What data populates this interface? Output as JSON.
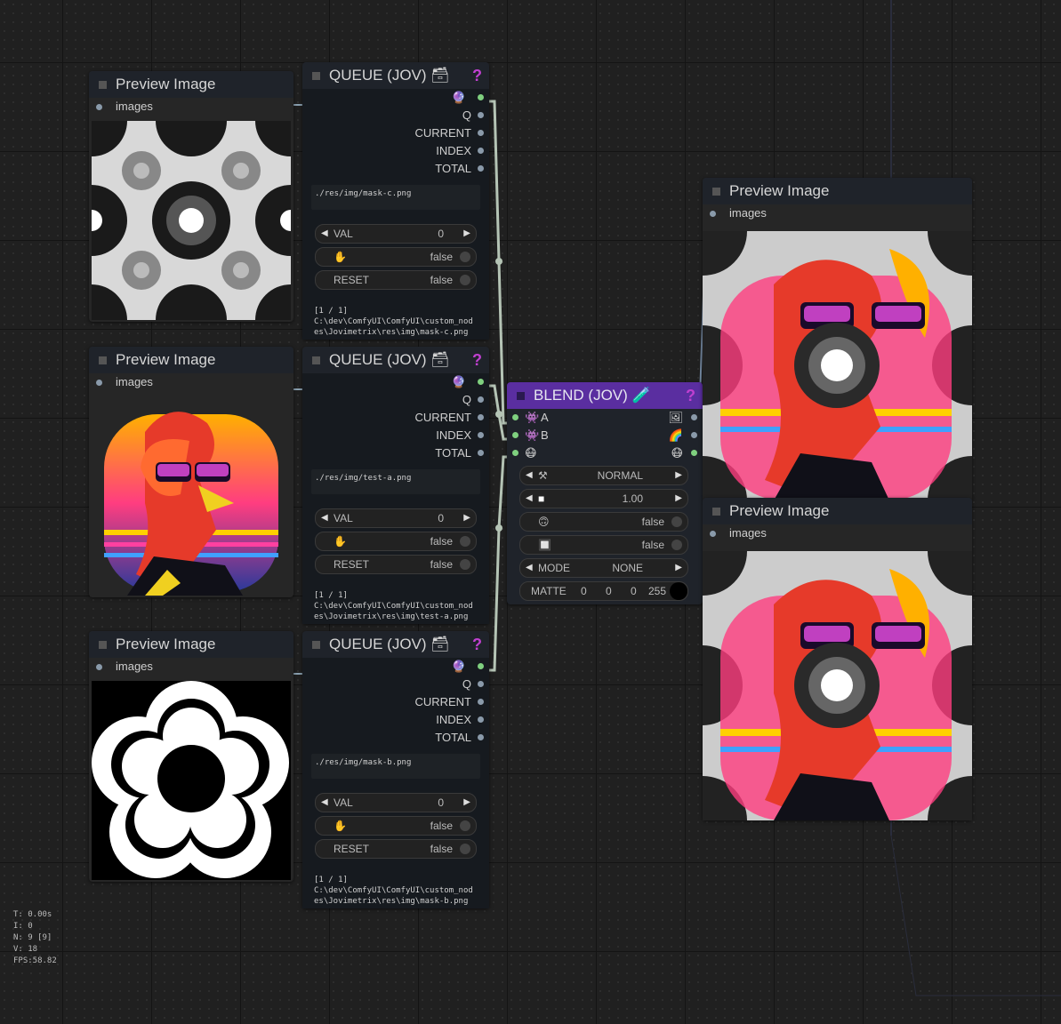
{
  "preview": {
    "title": "Preview Image",
    "input_label": "images"
  },
  "queues": [
    {
      "title": "QUEUE (JOV) 🗃",
      "help": "?",
      "outputs": [
        "Q",
        "CURRENT",
        "INDEX",
        "TOTAL"
      ],
      "path": "./res/img/mask-c.png",
      "val_label": "VAL",
      "val": "0",
      "toggle_false": "false",
      "reset_label": "RESET",
      "status_line1": "[1 / 1]",
      "status_line2": "C:\\dev\\ComfyUI\\ComfyUI\\custom_nodes\\Jovimetrix\\res\\img\\mask-c.png"
    },
    {
      "title": "QUEUE (JOV) 🗃",
      "help": "?",
      "outputs": [
        "Q",
        "CURRENT",
        "INDEX",
        "TOTAL"
      ],
      "path": "./res/img/test-a.png",
      "val_label": "VAL",
      "val": "0",
      "toggle_false": "false",
      "reset_label": "RESET",
      "status_line1": "[1 / 1]",
      "status_line2": "C:\\dev\\ComfyUI\\ComfyUI\\custom_nodes\\Jovimetrix\\res\\img\\test-a.png"
    },
    {
      "title": "QUEUE (JOV) 🗃",
      "help": "?",
      "outputs": [
        "Q",
        "CURRENT",
        "INDEX",
        "TOTAL"
      ],
      "path": "./res/img/mask-b.png",
      "val_label": "VAL",
      "val": "0",
      "toggle_false": "false",
      "reset_label": "RESET",
      "status_line1": "[1 / 1]",
      "status_line2": "C:\\dev\\ComfyUI\\ComfyUI\\custom_nodes\\Jovimetrix\\res\\img\\mask-b.png"
    }
  ],
  "blend": {
    "title": "BLEND (JOV) 🧪",
    "help": "?",
    "input_a": "A",
    "input_b": "B",
    "func": "NORMAL",
    "alpha": "1.00",
    "flip_false": "false",
    "invert_false": "false",
    "mode_label": "MODE",
    "mode": "NONE",
    "matte_label": "MATTE",
    "matte": [
      "0",
      "0",
      "0",
      "255"
    ]
  },
  "stats": {
    "t": "T: 0.00s",
    "i": "I: 0",
    "n": "N: 9 [9]",
    "v": "V: 18",
    "fps": "FPS:58.82"
  }
}
